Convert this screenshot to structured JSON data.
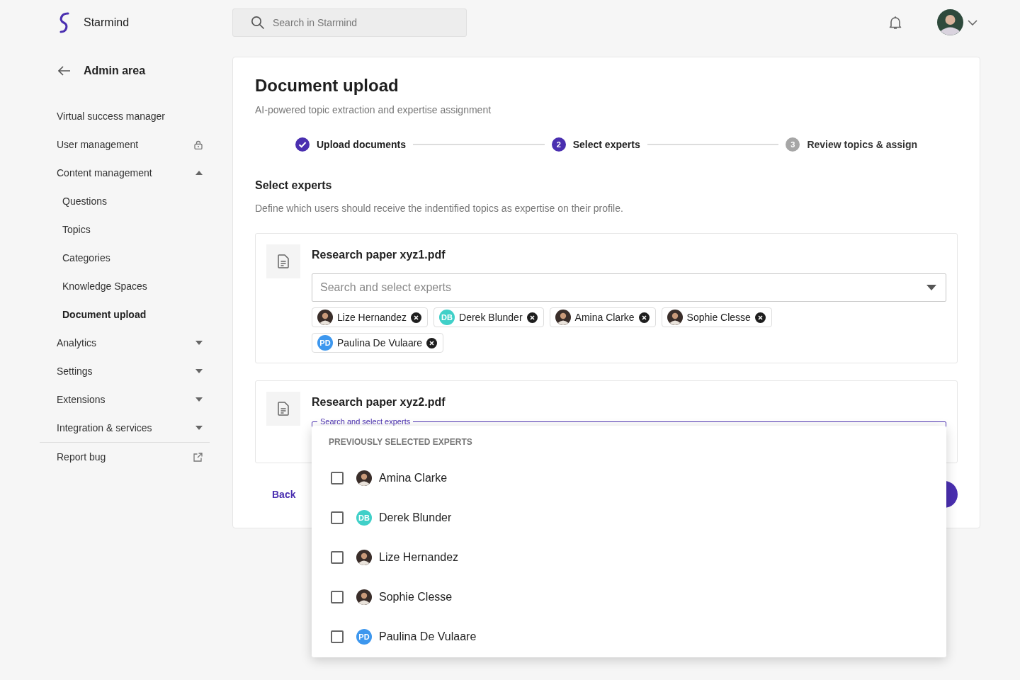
{
  "brand": {
    "name": "Starmind"
  },
  "search": {
    "placeholder": "Search in Starmind"
  },
  "sidebar": {
    "title": "Admin area",
    "items": [
      {
        "label": "Virtual success manager",
        "kind": "plain",
        "selected": false
      },
      {
        "label": "User management",
        "kind": "locked",
        "selected": false
      },
      {
        "label": "Content management",
        "kind": "expandable",
        "expanded": true,
        "selected": false,
        "children": [
          {
            "label": "Questions",
            "selected": false
          },
          {
            "label": "Topics",
            "selected": false
          },
          {
            "label": "Categories",
            "selected": false
          },
          {
            "label": "Knowledge Spaces",
            "selected": false
          },
          {
            "label": "Document upload",
            "selected": true
          }
        ]
      },
      {
        "label": "Analytics",
        "kind": "expandable",
        "expanded": false,
        "selected": false
      },
      {
        "label": "Settings",
        "kind": "expandable",
        "expanded": false,
        "selected": false
      },
      {
        "label": "Extensions",
        "kind": "expandable",
        "expanded": false,
        "selected": false
      },
      {
        "label": "Integration & services",
        "kind": "expandable",
        "expanded": false,
        "selected": false
      }
    ],
    "footer": {
      "label": "Report bug",
      "kind": "external"
    }
  },
  "page": {
    "title": "Document upload",
    "subtitle": "AI-powered topic extraction and expertise assignment"
  },
  "steps": [
    {
      "label": "Upload documents",
      "kind": "done"
    },
    {
      "label": "Select experts",
      "kind": "current",
      "number": "2"
    },
    {
      "label": "Review topics & assign",
      "kind": "upcoming",
      "number": "3"
    }
  ],
  "section": {
    "title": "Select experts",
    "description": "Define which users should receive the indentified topics as expertise on their profile."
  },
  "files": [
    {
      "name": "Research paper xyz1.pdf",
      "field": {
        "placeholder": "Search and select experts",
        "focused": false
      },
      "chips": [
        {
          "name": "Lize Hernandez",
          "avatar": {
            "kind": "photo"
          }
        },
        {
          "name": "Derek Blunder",
          "avatar": {
            "kind": "initials",
            "text": "DB",
            "color": "#40d0c8"
          }
        },
        {
          "name": "Amina Clarke",
          "avatar": {
            "kind": "photo"
          }
        },
        {
          "name": "Sophie Clesse",
          "avatar": {
            "kind": "photo"
          }
        },
        {
          "name": "Paulina De Vulaare",
          "avatar": {
            "kind": "initials",
            "text": "PD",
            "color": "#3d97ee"
          }
        }
      ]
    },
    {
      "name": "Research paper xyz2.pdf",
      "field": {
        "placeholder": "Search and select experts",
        "focused": true
      },
      "dropdown": {
        "heading": "PREVIOUSLY SELECTED EXPERTS",
        "options": [
          {
            "name": "Amina Clarke",
            "checked": false,
            "avatar": {
              "kind": "photo"
            }
          },
          {
            "name": "Derek Blunder",
            "checked": false,
            "avatar": {
              "kind": "initials",
              "text": "DB",
              "color": "#40d0c8"
            }
          },
          {
            "name": "Lize Hernandez",
            "checked": false,
            "avatar": {
              "kind": "photo"
            }
          },
          {
            "name": "Sophie Clesse",
            "checked": false,
            "avatar": {
              "kind": "photo"
            }
          },
          {
            "name": "Paulina De Vulaare",
            "checked": false,
            "avatar": {
              "kind": "initials",
              "text": "PD",
              "color": "#3d97ee"
            }
          }
        ]
      }
    }
  ],
  "actions": {
    "back": "Back"
  }
}
